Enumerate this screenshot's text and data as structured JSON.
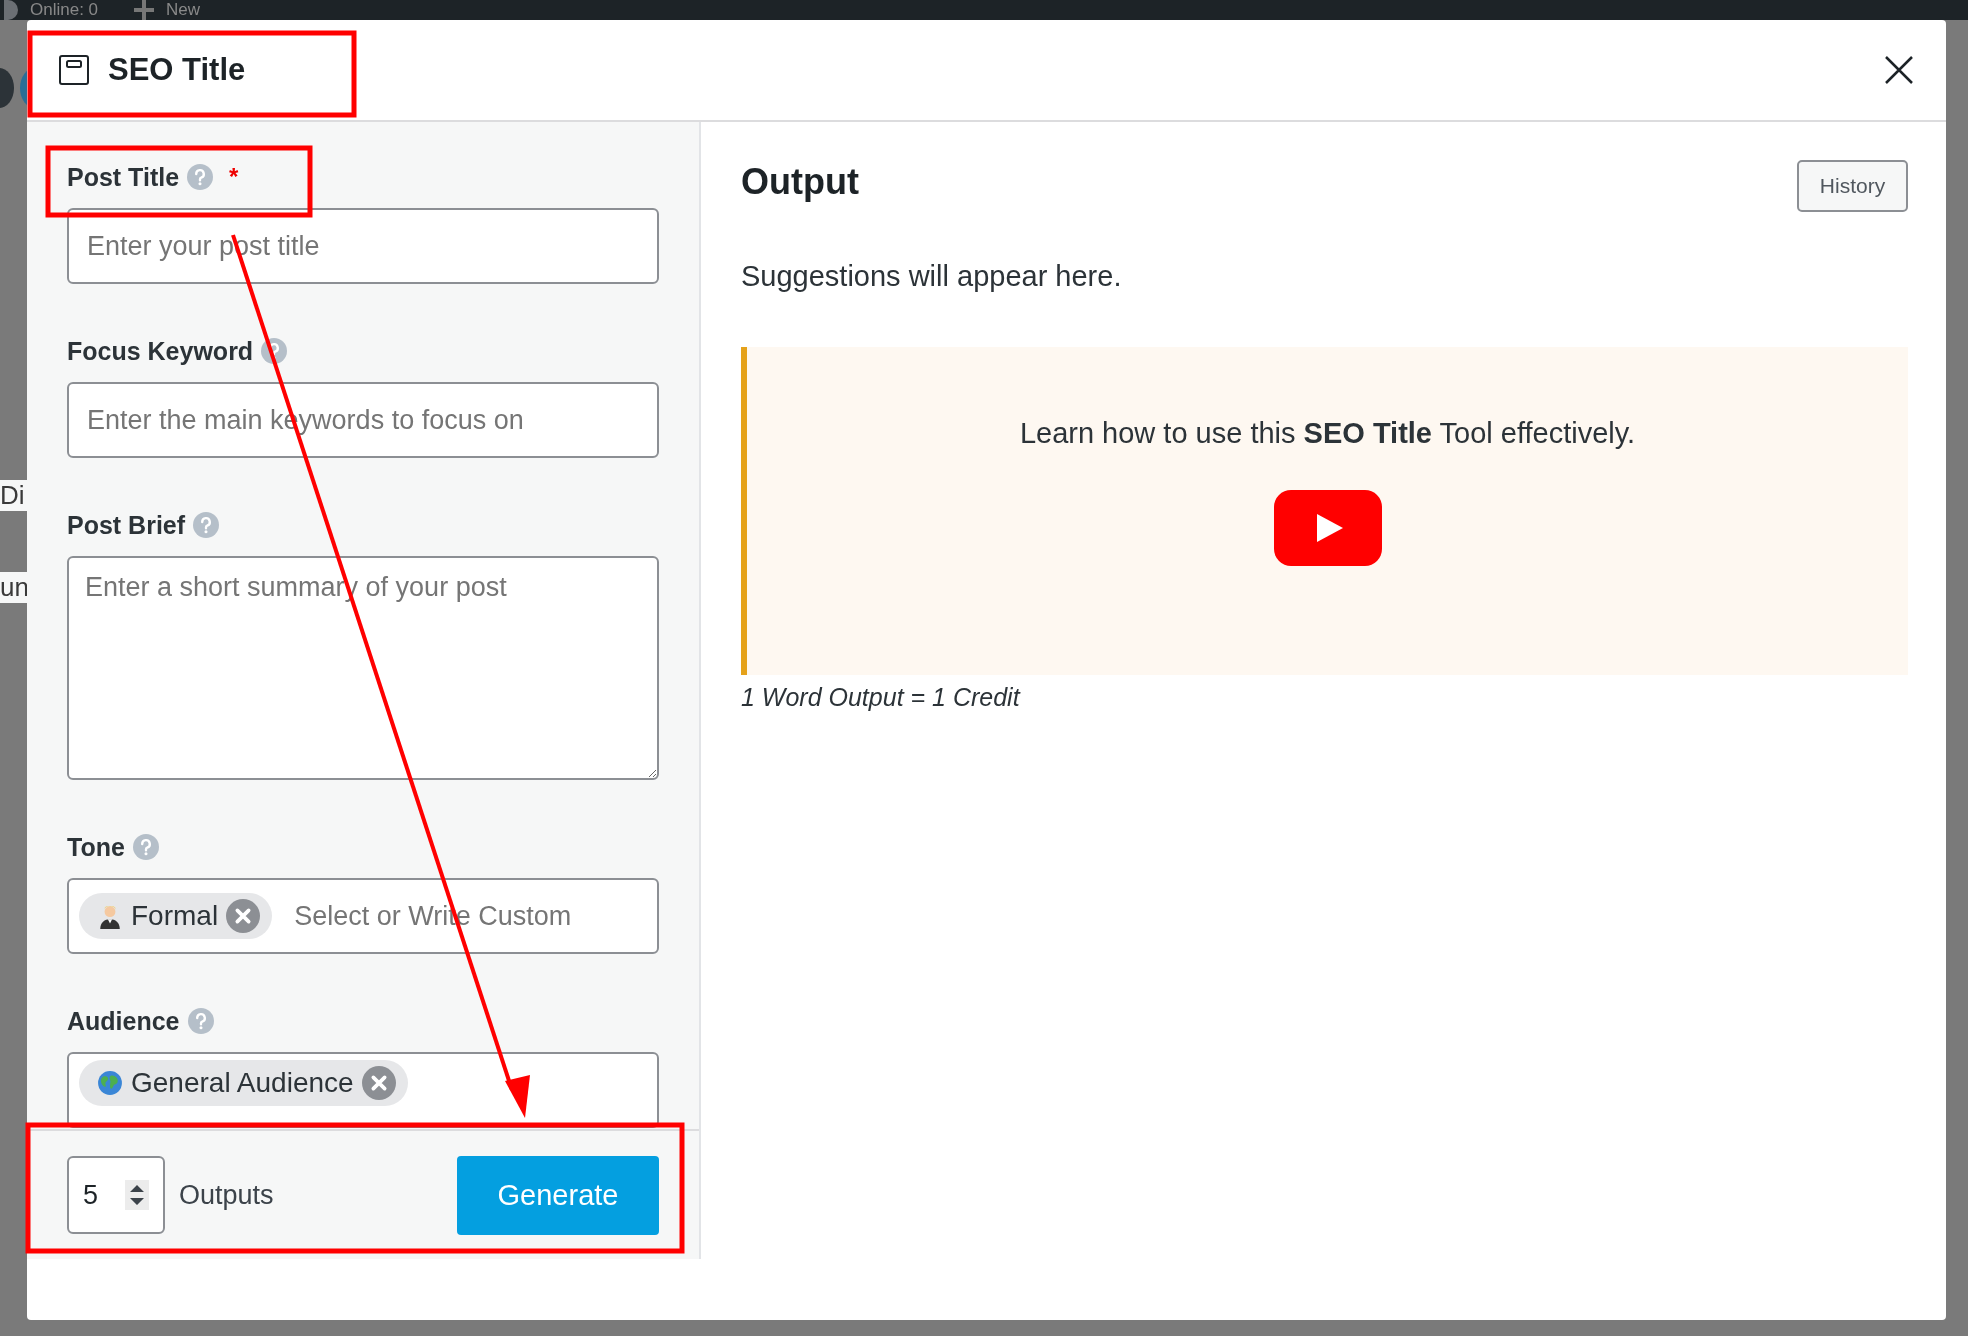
{
  "background": {
    "top_bar": [
      "Online: 0",
      "New"
    ],
    "left_fragments": [
      "Di",
      "un"
    ]
  },
  "modal": {
    "title": "SEO Title"
  },
  "form": {
    "fields": [
      {
        "kind": "input",
        "label": "Post Title",
        "required_mark": "*",
        "placeholder": "Enter your post title"
      },
      {
        "kind": "input",
        "label": "Focus Keyword",
        "placeholder": "Enter the main keywords to focus on"
      },
      {
        "kind": "textarea",
        "label": "Post Brief",
        "placeholder": "Enter a short summary of your post"
      },
      {
        "kind": "tags",
        "label": "Tone",
        "tags": [
          {
            "kind": "person",
            "label": "Formal"
          }
        ],
        "placeholder": "Select or Write Custom"
      },
      {
        "kind": "tags",
        "label": "Audience",
        "tags": [
          {
            "kind": "globe",
            "label": "General Audience"
          }
        ]
      }
    ]
  },
  "footer": {
    "outputs_value": "5",
    "outputs_label": "Outputs",
    "generate_button": "Generate"
  },
  "output": {
    "heading": "Output",
    "history_button": "History",
    "empty_text": "Suggestions will appear here.",
    "tutorial_text": "Learn how to use this **SEO Title** Tool effectively.",
    "credit_note": "1 Word Output = 1 Credit"
  }
}
